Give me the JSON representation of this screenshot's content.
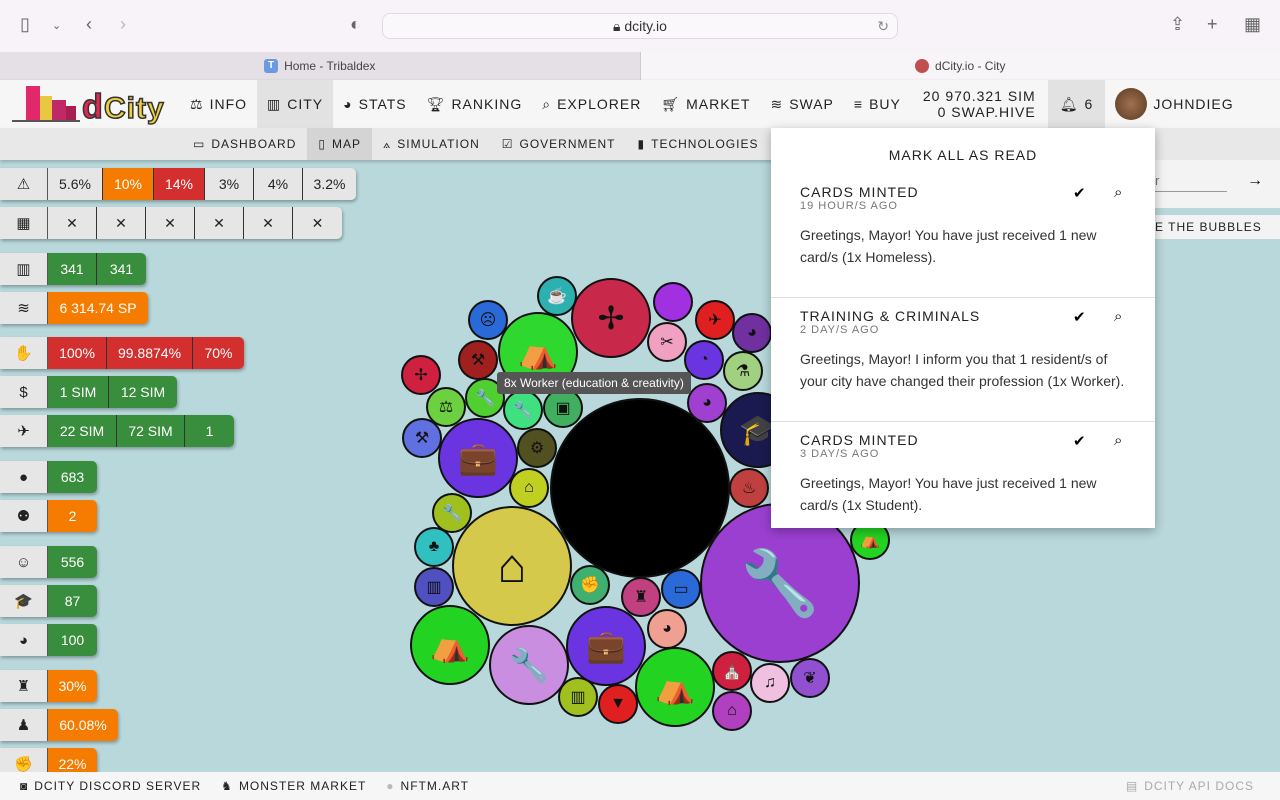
{
  "browser": {
    "url": "dcity.io",
    "tabs": [
      {
        "label": "Home - Tribaldex",
        "favicon": "T",
        "active": false
      },
      {
        "label": "dCity.io - City",
        "active": true
      }
    ]
  },
  "nav": {
    "logo": "dCity",
    "items": [
      {
        "label": "INFO",
        "icon": "scale-icon"
      },
      {
        "label": "CITY",
        "icon": "city-icon",
        "selected": true
      },
      {
        "label": "STATS",
        "icon": "chart-pie-icon"
      },
      {
        "label": "RANKING",
        "icon": "trophy-icon"
      },
      {
        "label": "EXPLORER",
        "icon": "search-icon"
      },
      {
        "label": "MARKET",
        "icon": "cart-icon"
      },
      {
        "label": "SWAP",
        "icon": "coins-icon"
      },
      {
        "label": "BUY",
        "icon": "layers-icon"
      }
    ],
    "balance_sim": "20 970.321 SIM",
    "balance_hive": "0 SWAP.HIVE",
    "notifications": "6",
    "user": "JOHNDIEG"
  },
  "subnav": [
    {
      "label": "DASHBOARD",
      "icon": "laptop-icon"
    },
    {
      "label": "MAP",
      "icon": "tablet-icon",
      "selected": true
    },
    {
      "label": "SIMULATION",
      "icon": "compass-icon"
    },
    {
      "label": "GOVERNMENT",
      "icon": "vote-icon"
    },
    {
      "label": "TECHNOLOGIES",
      "icon": "chip-icon"
    }
  ],
  "stats": [
    {
      "icon": "warning-icon",
      "glyph": "⚠",
      "cells": [
        {
          "v": "5.6%",
          "c": "n"
        },
        {
          "v": "10%",
          "c": "o"
        },
        {
          "v": "14%",
          "c": "r"
        },
        {
          "v": "3%",
          "c": "n"
        },
        {
          "v": "4%",
          "c": "n"
        },
        {
          "v": "3.2%",
          "c": "n"
        }
      ]
    },
    {
      "icon": "calendar-icon",
      "glyph": "▦",
      "cells": [
        {
          "v": "✕",
          "c": "n"
        },
        {
          "v": "✕",
          "c": "n"
        },
        {
          "v": "✕",
          "c": "n"
        },
        {
          "v": "✕",
          "c": "n"
        },
        {
          "v": "✕",
          "c": "n"
        },
        {
          "v": "✕",
          "c": "n"
        }
      ]
    },
    {
      "icon": "building-icon",
      "glyph": "▥",
      "cells": [
        {
          "v": "341",
          "c": "g"
        },
        {
          "v": "341",
          "c": "g"
        }
      ]
    },
    {
      "icon": "coins-icon",
      "glyph": "≋",
      "cells": [
        {
          "v": "6 314.74 SP",
          "c": "o"
        }
      ]
    },
    {
      "icon": "hand-money-icon",
      "glyph": "✋",
      "cells": [
        {
          "v": "100%",
          "c": "r"
        },
        {
          "v": "99.8874%",
          "c": "r"
        },
        {
          "v": "70%",
          "c": "r"
        }
      ]
    },
    {
      "icon": "dollar-icon",
      "glyph": "$",
      "cells": [
        {
          "v": "1 SIM",
          "c": "g"
        },
        {
          "v": "12 SIM",
          "c": "g"
        }
      ]
    },
    {
      "icon": "plane-icon",
      "glyph": "✈",
      "cells": [
        {
          "v": "22 SIM",
          "c": "g"
        },
        {
          "v": "72 SIM",
          "c": "g"
        },
        {
          "v": "1",
          "c": "g"
        }
      ]
    },
    {
      "icon": "user-icon",
      "glyph": "●",
      "cells": [
        {
          "v": "683",
          "c": "g"
        }
      ]
    },
    {
      "icon": "users-icon",
      "glyph": "⚉",
      "cells": [
        {
          "v": "2",
          "c": "o"
        }
      ]
    },
    {
      "icon": "smile-icon",
      "glyph": "☺",
      "cells": [
        {
          "v": "556",
          "c": "g"
        }
      ]
    },
    {
      "icon": "graduation-icon",
      "glyph": "🎓",
      "cells": [
        {
          "v": "87",
          "c": "g"
        }
      ]
    },
    {
      "icon": "palette-icon",
      "glyph": "◕",
      "cells": [
        {
          "v": "100",
          "c": "g"
        }
      ]
    },
    {
      "icon": "spy-icon",
      "glyph": "♜",
      "cells": [
        {
          "v": "30%",
          "c": "o"
        }
      ]
    },
    {
      "icon": "teacher-icon",
      "glyph": "♟",
      "cells": [
        {
          "v": "60.08%",
          "c": "o"
        }
      ]
    },
    {
      "icon": "fist-icon",
      "glyph": "✊",
      "cells": [
        {
          "v": "22%",
          "c": "o"
        }
      ]
    }
  ],
  "tooltip": "8x Worker (education & creativity)",
  "bubbles": [
    {
      "color": "#000000",
      "icon": "none",
      "g": ""
    },
    {
      "color": "#9b3fd0",
      "icon": "wrench-icon",
      "g": "🔧"
    },
    {
      "color": "#d4c94a",
      "icon": "home-icon",
      "g": "⌂"
    },
    {
      "color": "#c8284a",
      "icon": "pinwheel-icon",
      "g": "✢"
    },
    {
      "color": "#2fd82f",
      "icon": "tent-icon",
      "g": "⛺"
    },
    {
      "color": "#6a35e0",
      "icon": "briefcase-icon",
      "g": "💼"
    },
    {
      "color": "#22d322",
      "icon": "tent-icon",
      "g": "⛺"
    },
    {
      "color": "#c98ee0",
      "icon": "wrench-icon",
      "g": "🔧"
    },
    {
      "color": "#6a35e0",
      "icon": "briefcase-icon",
      "g": "💼"
    },
    {
      "color": "#22d322",
      "icon": "tent-icon",
      "g": "⛺"
    },
    {
      "color": "#1a1a50",
      "icon": "graduation-icon",
      "g": "🎓"
    },
    {
      "color": "#2cb0b0",
      "icon": "mug-icon",
      "g": "☕"
    },
    {
      "color": "#a030e0",
      "icon": "none",
      "g": ""
    },
    {
      "color": "#2a6ad8",
      "icon": "sad-icon",
      "g": "☹"
    },
    {
      "color": "#e02020",
      "icon": "plane-icon",
      "g": "✈"
    },
    {
      "color": "#a02020",
      "icon": "dumbbell-icon",
      "g": "⚒"
    },
    {
      "color": "#f0a0c0",
      "icon": "scissors-icon",
      "g": "✂"
    },
    {
      "color": "#7030a0",
      "icon": "palette-icon",
      "g": "◕"
    },
    {
      "color": "#d02040",
      "icon": "pinwheel-icon",
      "g": "✢"
    },
    {
      "color": "#6a35e0",
      "icon": "satellite-icon",
      "g": "◔"
    },
    {
      "color": "#a0d080",
      "icon": "flask-icon",
      "g": "⚗"
    },
    {
      "color": "#6cd040",
      "icon": "scales-icon",
      "g": "⚖"
    },
    {
      "color": "#50d030",
      "icon": "wrench-icon",
      "g": "🔧"
    },
    {
      "color": "#40e080",
      "icon": "wrench-icon",
      "g": "🔧"
    },
    {
      "color": "#40b060",
      "icon": "image-icon",
      "g": "▣"
    },
    {
      "color": "#a040d0",
      "icon": "palette-icon",
      "g": "◕"
    },
    {
      "color": "#6070e0",
      "icon": "gavel-icon",
      "g": "⚒"
    },
    {
      "color": "#505020",
      "icon": "tractor-icon",
      "g": "⚙"
    },
    {
      "color": "#c0d020",
      "icon": "bank-icon",
      "g": "⌂"
    },
    {
      "color": "#a0c020",
      "icon": "wrench-icon",
      "g": "🔧"
    },
    {
      "color": "#c04040",
      "icon": "extinguisher-icon",
      "g": "♨"
    },
    {
      "color": "#30c0c0",
      "icon": "tree-icon",
      "g": "♣"
    },
    {
      "color": "#5050c0",
      "icon": "building-icon",
      "g": "▥"
    },
    {
      "color": "#40b070",
      "icon": "fist-icon",
      "g": "✊"
    },
    {
      "color": "#c04080",
      "icon": "spy-icon",
      "g": "♜"
    },
    {
      "color": "#2a6ad8",
      "icon": "money-icon",
      "g": "▭"
    },
    {
      "color": "#f0a090",
      "icon": "palette-icon",
      "g": "◕"
    },
    {
      "color": "#22d322",
      "icon": "tent-icon",
      "g": "⛺"
    },
    {
      "color": "#d02040",
      "icon": "church-icon",
      "g": "⛪"
    },
    {
      "color": "#f0c0e0",
      "icon": "music-icon",
      "g": "♫"
    },
    {
      "color": "#9050d0",
      "icon": "leaf-icon",
      "g": "❦"
    },
    {
      "color": "#b040c0",
      "icon": "home-icon",
      "g": "⌂"
    },
    {
      "color": "#a0c020",
      "icon": "building-icon",
      "g": "▥"
    },
    {
      "color": "#e02020",
      "icon": "icecream-icon",
      "g": "▼"
    }
  ],
  "notifications": {
    "mark_all": "MARK ALL AS READ",
    "items": [
      {
        "title": "CARDS MINTED",
        "ago": "19 HOUR/S AGO",
        "text": "Greetings, Mayor! You have just received 1 new card/s (1x Homeless)."
      },
      {
        "title": "TRAINING & CRIMINALS",
        "ago": "2 DAY/S AGO",
        "text": "Greetings, Mayor! I inform you that 1 resident/s of your city have changed their profession (1x Worker)."
      },
      {
        "title": "CARDS MINTED",
        "ago": "3 DAY/S AGO",
        "text": "Greetings, Mayor! You have just received 1 new card/s (1x Student)."
      }
    ]
  },
  "right": {
    "search_placeholder": "r",
    "bubbles_button": "E THE BUBBLES"
  },
  "footer": {
    "discord": "DCITY DISCORD SERVER",
    "monster": "MONSTER MARKET",
    "nftm": "NFTM.ART",
    "api": "DCITY API DOCS"
  }
}
